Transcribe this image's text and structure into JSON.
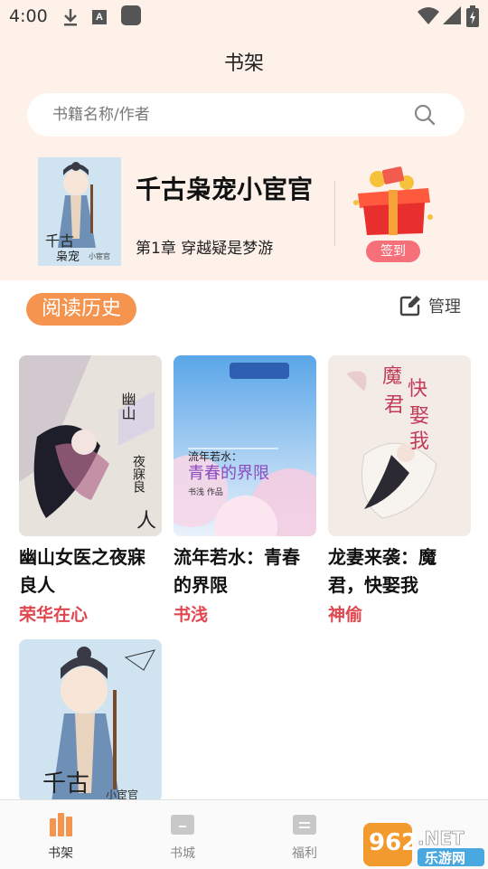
{
  "status_bar": {
    "time": "4:00",
    "icons": [
      "download-icon",
      "a-icon",
      "app-square-icon",
      "wifi-icon",
      "signal-icon",
      "battery-icon"
    ]
  },
  "header": {
    "title": "书架"
  },
  "search": {
    "placeholder": "书籍名称/作者"
  },
  "current_book": {
    "title": "千古枭宠小宦官",
    "chapter": "第1章    穿越疑是梦游",
    "signin_label": "签到"
  },
  "history": {
    "label": "阅读历史",
    "manage_label": "管理"
  },
  "books": [
    {
      "title": "幽山女医之夜寐良人",
      "author": "荣华在心"
    },
    {
      "title": "流年若水：青春的界限",
      "author": "书浅"
    },
    {
      "title": "龙妻来袭：魔君，快娶我",
      "author": "神偷"
    },
    {
      "title": "",
      "author": ""
    }
  ],
  "bottom_nav": {
    "items": [
      {
        "label": "书架",
        "icon": "bookshelf-icon",
        "active": true
      },
      {
        "label": "书城",
        "icon": "bookstore-icon",
        "active": false
      },
      {
        "label": "福利",
        "icon": "welfare-icon",
        "active": false
      }
    ]
  },
  "watermark": {
    "line1": "962.NET",
    "line2": "乐游网"
  },
  "colors": {
    "accent": "#f5944e",
    "author_red": "#e0474f",
    "signin_pink": "#f6707a",
    "header_bg": "#fdf1ea"
  }
}
